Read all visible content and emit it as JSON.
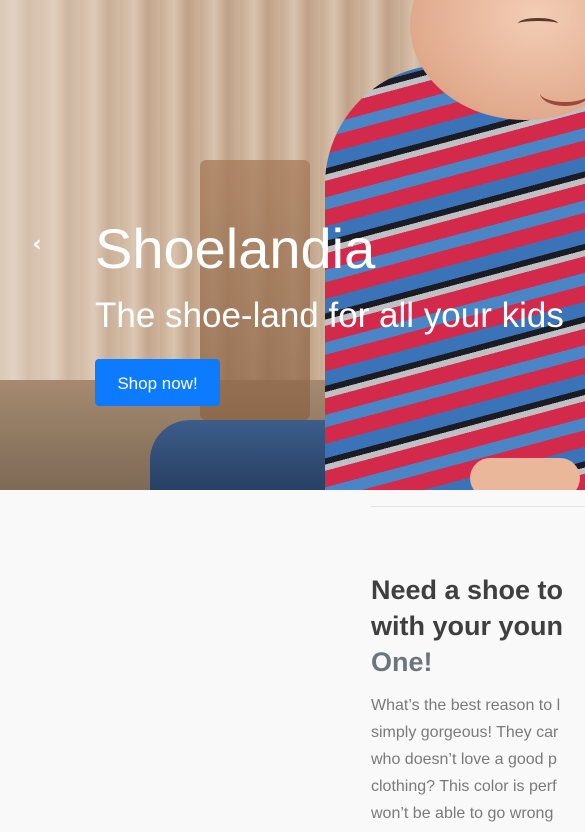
{
  "hero": {
    "title": "Shoelandia",
    "subtitle": "The shoe-land for all your kids",
    "cta_label": "Shop now!",
    "prev_arrow": "‹",
    "accent_color": "#0d7bff"
  },
  "featurette": {
    "heading_lines": [
      "Need a shoe to",
      "with your youn"
    ],
    "heading_muted": "One!",
    "body_lines": [
      "What’s the best reason to l",
      "simply gorgeous! They car",
      "who doesn’t love a good p",
      "clothing? This color is perf",
      "won’t be able to go wrong"
    ]
  }
}
